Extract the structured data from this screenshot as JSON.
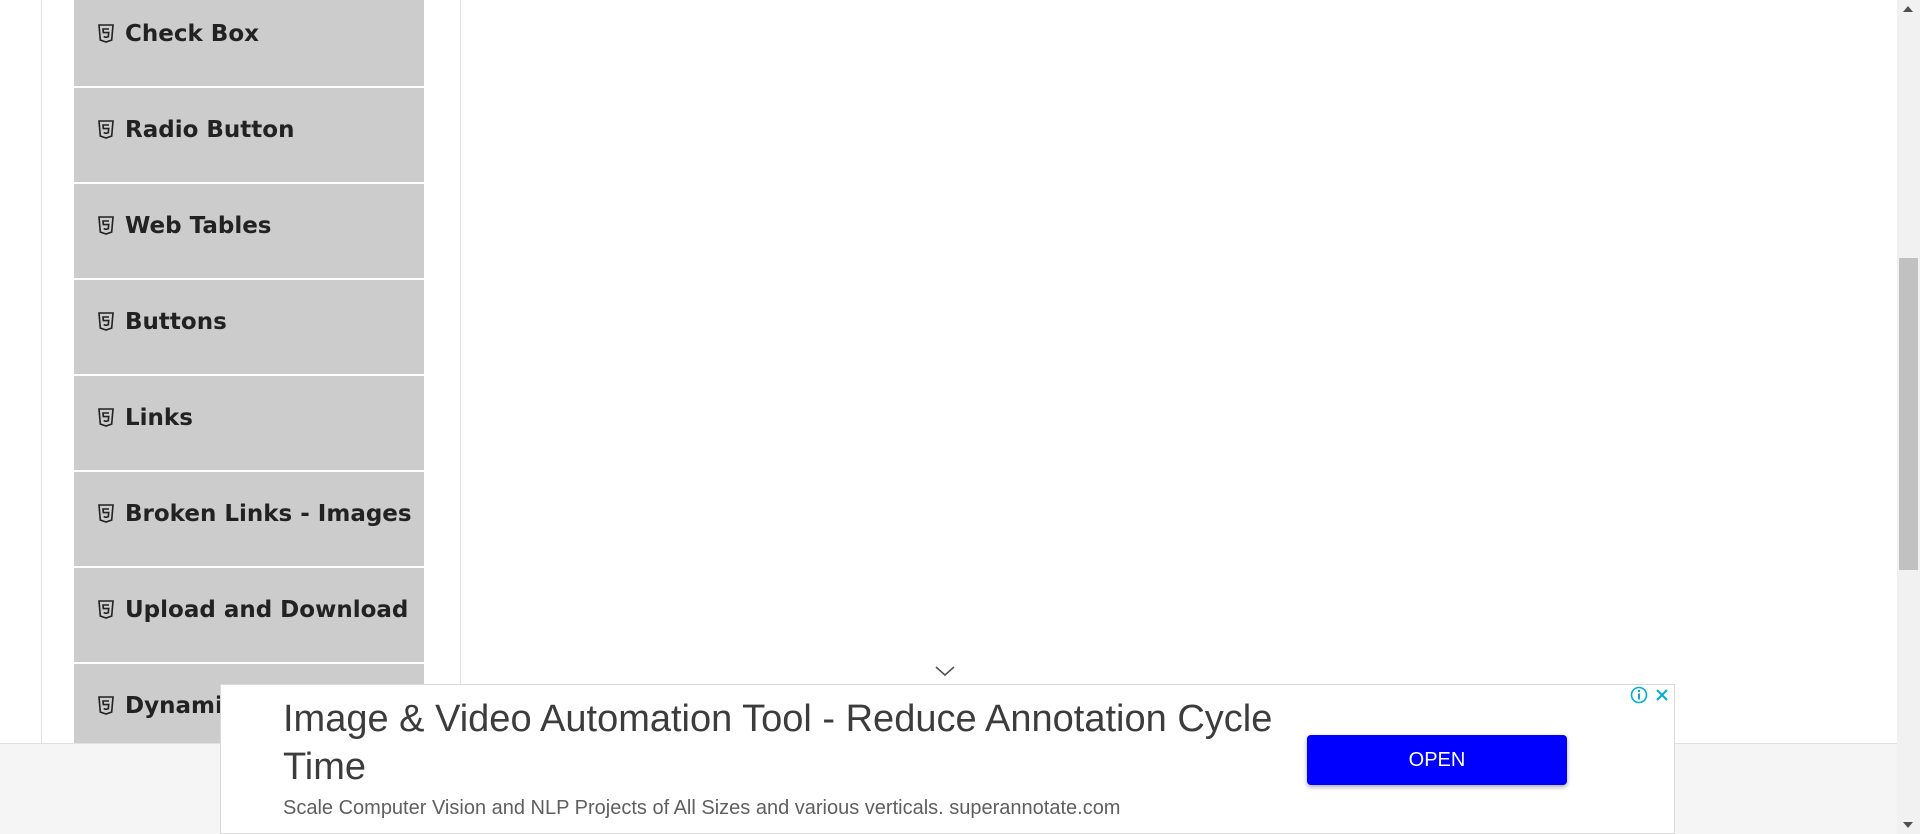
{
  "sidebar": {
    "items": [
      {
        "label": "Check Box"
      },
      {
        "label": "Radio Button"
      },
      {
        "label": "Web Tables"
      },
      {
        "label": "Buttons"
      },
      {
        "label": "Links"
      },
      {
        "label": "Broken Links - Images"
      },
      {
        "label": "Upload and Download"
      },
      {
        "label": "Dynamic Properties"
      }
    ],
    "item_icon": "html5-icon",
    "item_bg": "#cccccc"
  },
  "ad": {
    "title": "Image & Video Automation Tool - Reduce Annotation Cycle Time",
    "description": "Scale Computer Vision and NLP Projects of All Sizes and various verticals. superannotate.com",
    "open_label": "OPEN",
    "open_color": "#0000ff",
    "icons": [
      "chevron-down-icon",
      "info-icon",
      "close-icon"
    ]
  }
}
